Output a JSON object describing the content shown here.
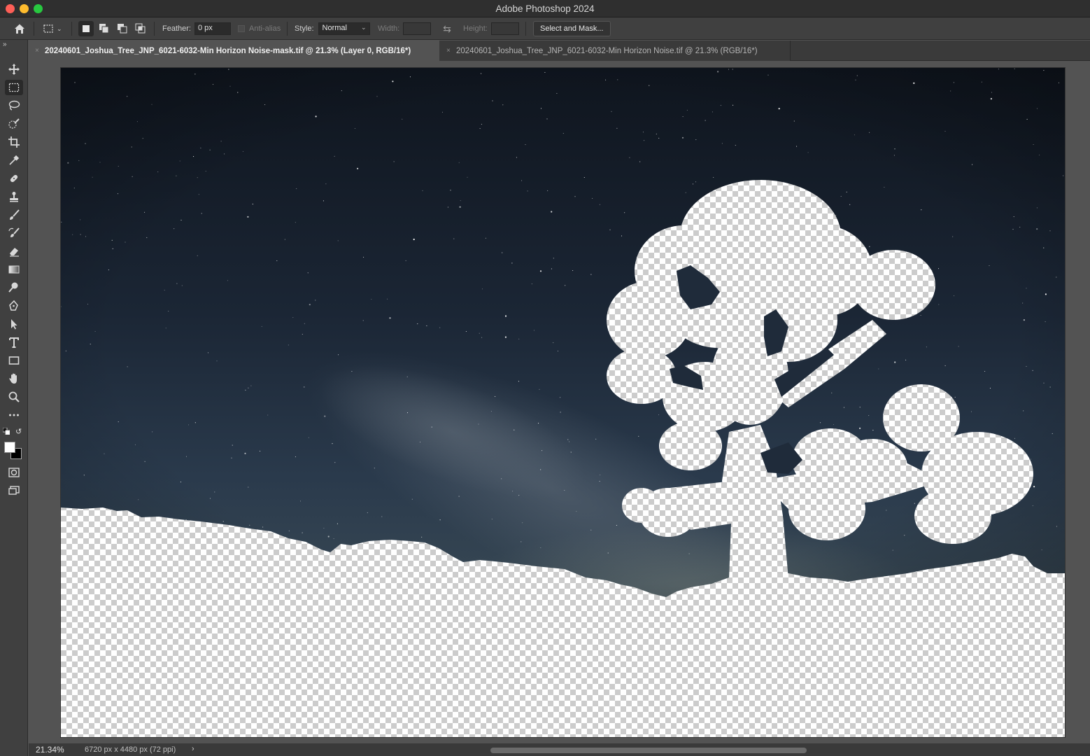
{
  "window": {
    "title": "Adobe Photoshop 2024"
  },
  "options_bar": {
    "feather_label": "Feather:",
    "feather_value": "0 px",
    "antialias_label": "Anti-alias",
    "style_label": "Style:",
    "style_value": "Normal",
    "width_label": "Width:",
    "height_label": "Height:",
    "select_and_mask_label": "Select and Mask..."
  },
  "tabs": [
    {
      "label": "20240601_Joshua_Tree_JNP_6021-6032-Min Horizon Noise-mask.tif @ 21.3% (Layer 0, RGB/16*)",
      "active": true
    },
    {
      "label": "20240601_Joshua_Tree_JNP_6021-6032-Min Horizon Noise.tif @ 21.3% (RGB/16*)",
      "active": false
    }
  ],
  "tools": [
    "move-tool-icon",
    "rectangular-marquee-tool-icon",
    "lasso-tool-icon",
    "quick-selection-tool-icon",
    "crop-tool-icon",
    "eyedropper-tool-icon",
    "spot-healing-brush-tool-icon",
    "clone-stamp-tool-icon",
    "brush-tool-icon",
    "history-brush-tool-icon",
    "eraser-tool-icon",
    "gradient-tool-icon",
    "dodge-tool-icon",
    "pen-tool-icon",
    "path-selection-tool-icon",
    "type-tool-icon",
    "rectangle-tool-icon",
    "hand-tool-icon",
    "zoom-tool-icon",
    "more-tools-icon"
  ],
  "active_tool": "rectangular-marquee-tool-icon",
  "colors": {
    "foreground": "#ffffff",
    "background": "#000000"
  },
  "status": {
    "zoom": "21.34%",
    "doc_info": "6720 px x 4480 px (72 ppi)"
  }
}
